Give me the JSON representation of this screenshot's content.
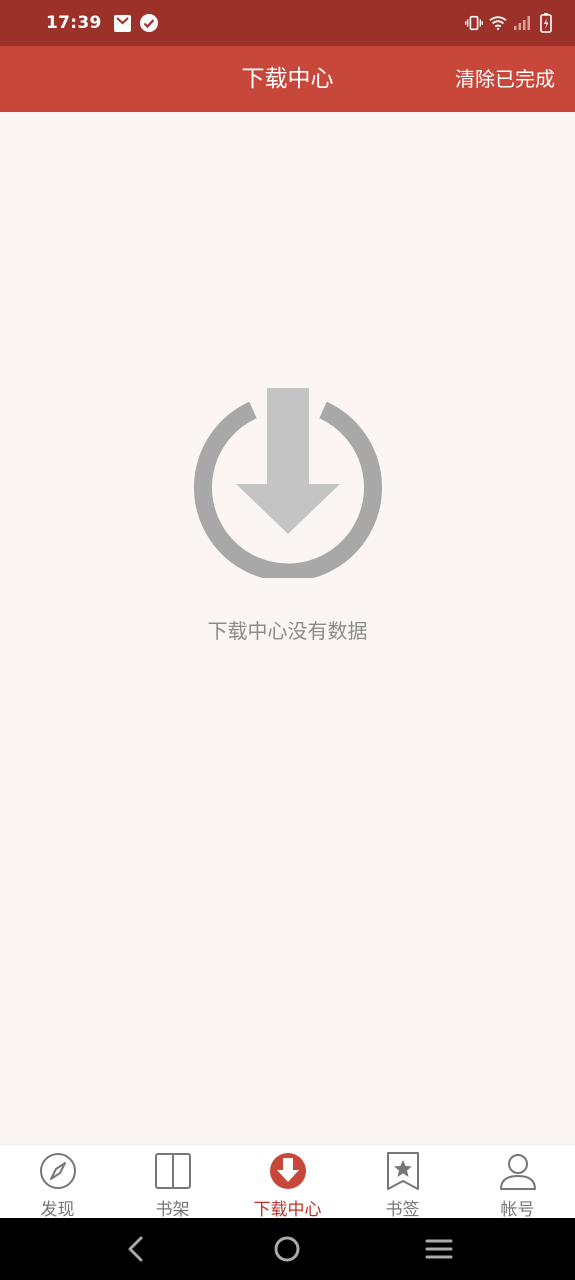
{
  "status": {
    "time": "17:39",
    "left_icons": [
      "mail-icon",
      "check-circle-icon"
    ],
    "right_icons": [
      "vibrate-icon",
      "wifi-icon",
      "signal-icon",
      "battery-icon"
    ]
  },
  "header": {
    "title": "下载中心",
    "clear_label": "清除已完成"
  },
  "main": {
    "empty_icon": "download-power-icon",
    "empty_text": "下载中心没有数据"
  },
  "bottom_nav": {
    "items": [
      {
        "label": "发现",
        "icon": "compass-icon",
        "active": false
      },
      {
        "label": "书架",
        "icon": "book-icon",
        "active": false
      },
      {
        "label": "下载中心",
        "icon": "download-icon",
        "active": true
      },
      {
        "label": "书签",
        "icon": "bookmark-star-icon",
        "active": false
      },
      {
        "label": "帐号",
        "icon": "user-icon",
        "active": false
      }
    ]
  },
  "colors": {
    "status_bar": "#9c3129",
    "app_bar": "#c8473b",
    "accent": "#b8332b",
    "background": "#fbf6f3"
  }
}
